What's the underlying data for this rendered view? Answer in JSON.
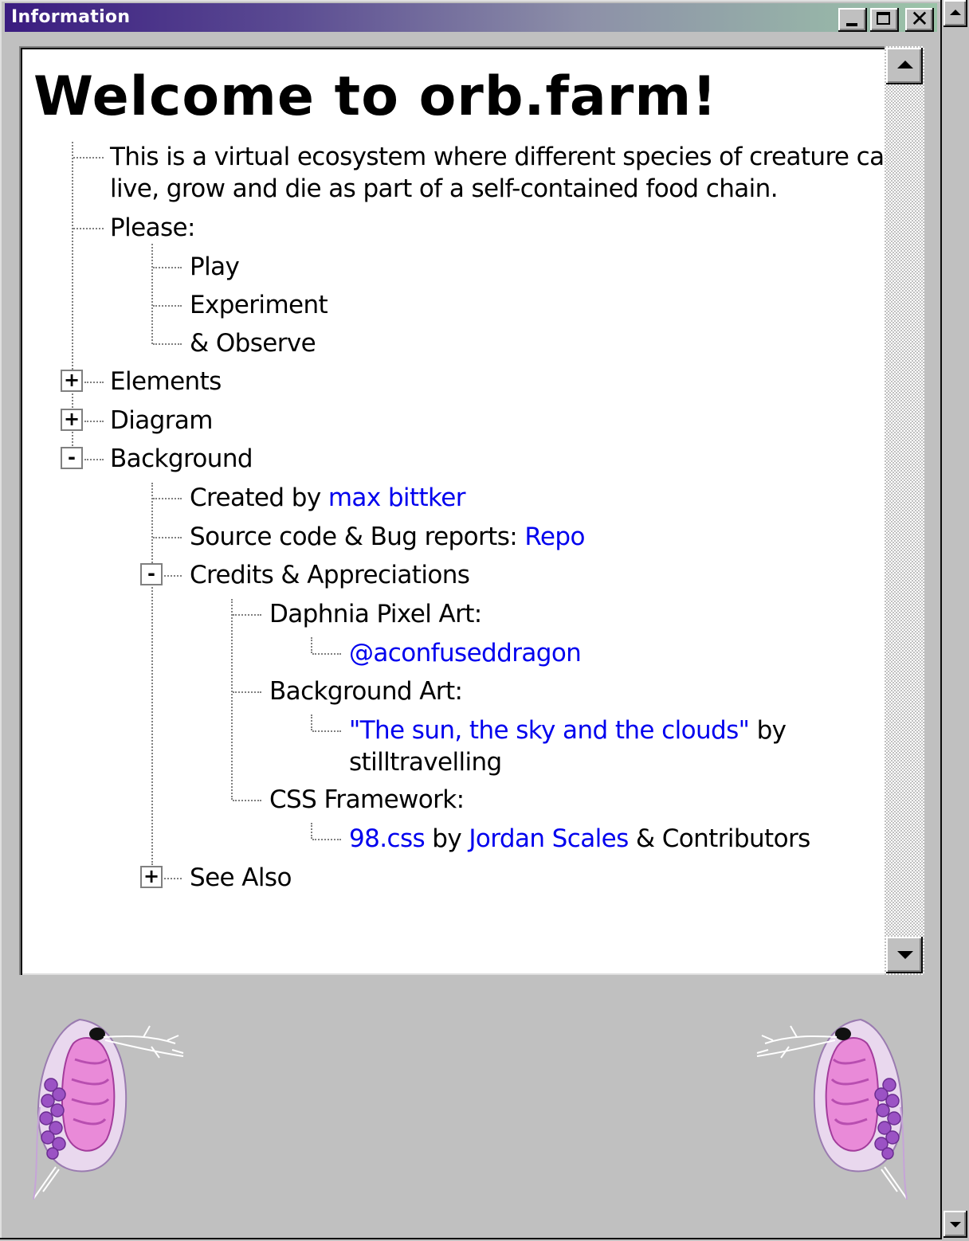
{
  "window": {
    "title": "Information"
  },
  "heading": "Welcome to orb.farm!",
  "tree": {
    "intro_line1": "This is a virtual ecosystem where different species of creature can",
    "intro_line2": "live, grow and die as part of a self-contained food chain.",
    "please": "Please:",
    "please_items": [
      "Play",
      "Experiment",
      "& Observe"
    ],
    "elements": "Elements",
    "diagram": "Diagram",
    "background": "Background",
    "created_by_prefix": "Created by ",
    "created_by_link": "max bittker",
    "source_prefix": "Source code & Bug reports: ",
    "source_link": "Repo",
    "credits": "Credits & Appreciations",
    "daphnia_label": "Daphnia Pixel Art:",
    "daphnia_link": "@aconfuseddragon",
    "bgart_label": "Background Art:",
    "bgart_link": "\"The sun, the sky and the clouds\"",
    "bgart_by": " by",
    "bgart_author": "stilltravelling",
    "css_label": "CSS Framework:",
    "css_link": "98.css",
    "css_by": " by ",
    "css_author_link": "Jordan Scales",
    "css_suffix": " & Contributors",
    "see_also": "See Also",
    "toggle_plus": "+",
    "toggle_minus": "-"
  },
  "colors": {
    "link": "#0000ee",
    "titlebar_start": "#3a1c80",
    "titlebar_end": "#9bc4a8",
    "face": "#c0c0c0"
  },
  "icons": [
    "minimize-icon",
    "maximize-icon",
    "close-icon",
    "scroll-up-icon",
    "scroll-down-icon",
    "expand-icon",
    "collapse-icon",
    "daphnia-icon"
  ]
}
